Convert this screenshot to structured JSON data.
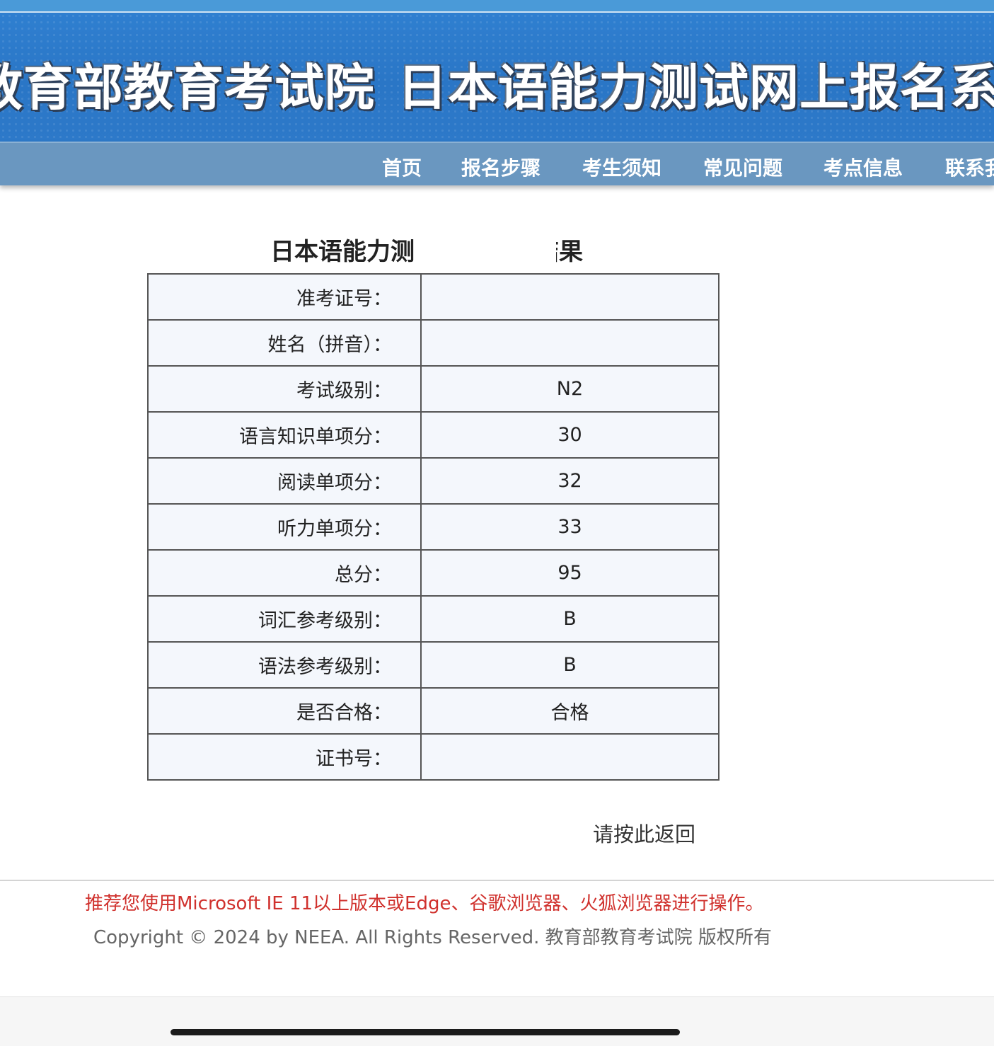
{
  "header": {
    "org_title": "教育部教育考试院",
    "system_title": "日本语能力测试网上报名系统"
  },
  "nav": {
    "items": [
      "首页",
      "报名步骤",
      "考生须知",
      "常见问题",
      "考点信息",
      "联系我"
    ]
  },
  "main": {
    "title": "日本语能力测试成绩查询结果",
    "rows": [
      {
        "label": "准考证号：",
        "value": ""
      },
      {
        "label": "姓名（拼音）：",
        "value": ""
      },
      {
        "label": "考试级别：",
        "value": "N2"
      },
      {
        "label": "语言知识单项分：",
        "value": "30"
      },
      {
        "label": "阅读单项分：",
        "value": "32"
      },
      {
        "label": "听力单项分：",
        "value": "33"
      },
      {
        "label": "总分：",
        "value": "95"
      },
      {
        "label": "词汇参考级别：",
        "value": "B"
      },
      {
        "label": "语法参考级别：",
        "value": "B"
      },
      {
        "label": "是否合格：",
        "value": "合格"
      },
      {
        "label": "证书号：",
        "value": ""
      }
    ],
    "back_link": "请按此返回"
  },
  "footer": {
    "recommend": "推荐您使用Microsoft IE 11以上版本或Edge、谷歌浏览器、火狐浏览器进行操作。",
    "copyright": "Copyright © 2024 by NEEA. All Rights Reserved. 教育部教育考试院 版权所有"
  },
  "colors": {
    "banner": "#2f7fd0",
    "nav": "#6a97c0",
    "table_bg": "#f4f7fc",
    "warning_text": "#d0312d"
  }
}
